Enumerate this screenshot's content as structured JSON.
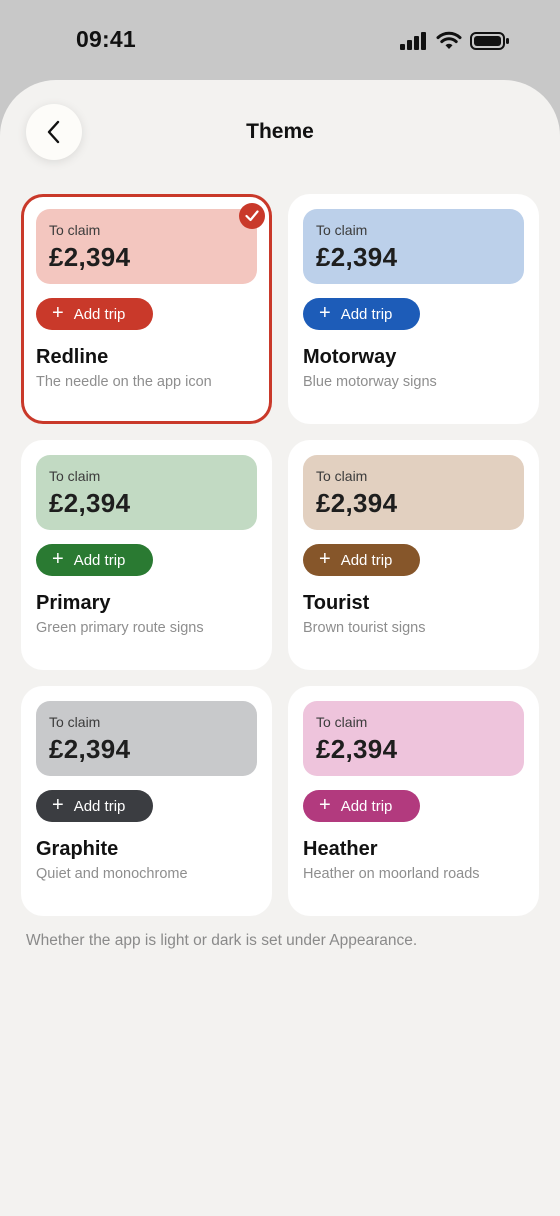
{
  "status": {
    "time": "09:41"
  },
  "header": {
    "title": "Theme",
    "back_icon": "chevron-left-icon"
  },
  "themes": [
    {
      "name": "Redline",
      "desc": "The needle on the app icon",
      "claim_label": "To claim",
      "amount": "£2,394",
      "button": "Add trip",
      "preview_color": "#f3c6bf",
      "accent": "#c9392a",
      "selected": true
    },
    {
      "name": "Motorway",
      "desc": "Blue motorway signs",
      "claim_label": "To claim",
      "amount": "£2,394",
      "button": "Add trip",
      "preview_color": "#bcd0ea",
      "accent": "#1d5cb8",
      "selected": false
    },
    {
      "name": "Primary",
      "desc": "Green primary route signs",
      "claim_label": "To claim",
      "amount": "£2,394",
      "button": "Add trip",
      "preview_color": "#c2dac3",
      "accent": "#2a7a32",
      "selected": false
    },
    {
      "name": "Tourist",
      "desc": "Brown tourist signs",
      "claim_label": "To claim",
      "amount": "£2,394",
      "button": "Add trip",
      "preview_color": "#e2d0c0",
      "accent": "#86562a",
      "selected": false
    },
    {
      "name": "Graphite",
      "desc": "Quiet and monochrome",
      "claim_label": "To claim",
      "amount": "£2,394",
      "button": "Add trip",
      "preview_color": "#c8c9cb",
      "accent": "#3b3d41",
      "selected": false
    },
    {
      "name": "Heather",
      "desc": "Heather on moorland roads",
      "claim_label": "To claim",
      "amount": "£2,394",
      "button": "Add trip",
      "preview_color": "#eec4dc",
      "accent": "#b23a7e",
      "selected": false
    }
  ],
  "footnote": "Whether the app is light or dark is set under Appearance."
}
